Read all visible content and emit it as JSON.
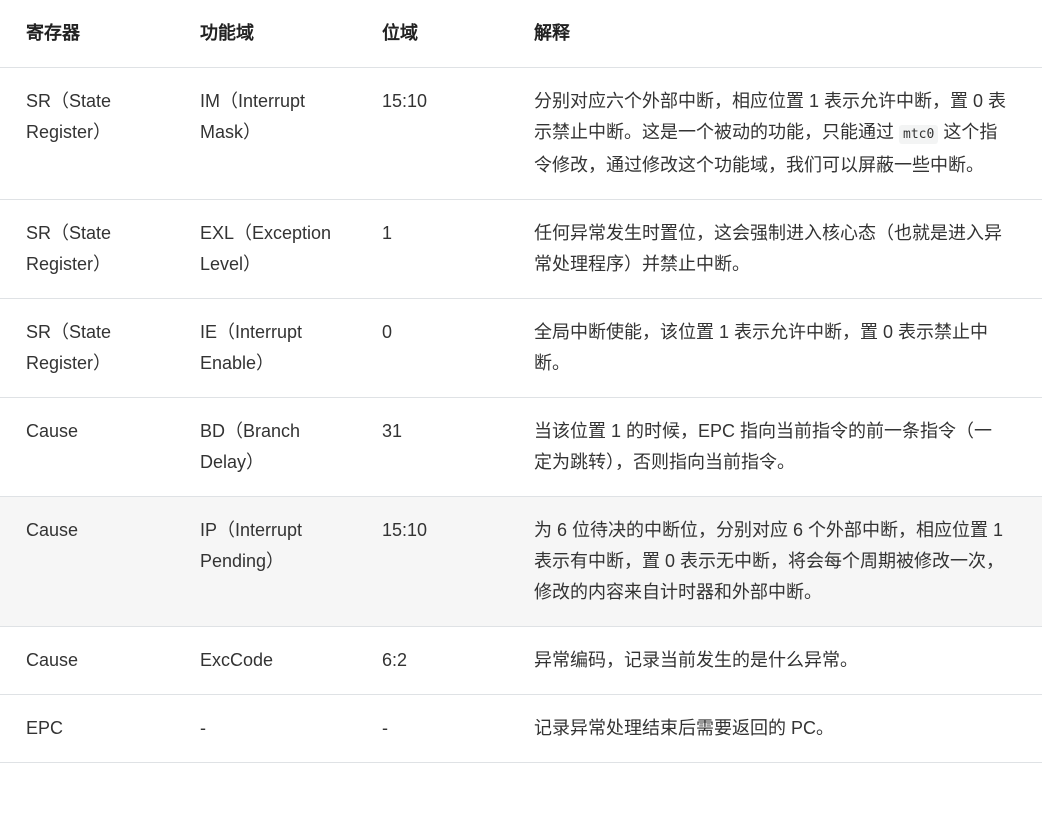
{
  "table": {
    "headers": [
      "寄存器",
      "功能域",
      "位域",
      "解释"
    ],
    "rows": [
      {
        "register": "SR（State Register）",
        "field": "IM（Interrupt Mask）",
        "bits": "15:10",
        "desc_before_code": "分别对应六个外部中断，相应位置 1 表示允许中断，置 0 表示禁止中断。这是一个被动的功能，只能通过 ",
        "desc_code": "mtc0",
        "desc_after_code": " 这个指令修改，通过修改这个功能域，我们可以屏蔽一些中断。"
      },
      {
        "register": "SR（State Register）",
        "field": "EXL（Exception Level）",
        "bits": "1",
        "desc": "任何异常发生时置位，这会强制进入核心态（也就是进入异常处理程序）并禁止中断。"
      },
      {
        "register": "SR（State Register）",
        "field": "IE（Interrupt Enable）",
        "bits": "0",
        "desc": "全局中断使能，该位置 1 表示允许中断，置 0 表示禁止中断。"
      },
      {
        "register": "Cause",
        "field": "BD（Branch Delay）",
        "bits": "31",
        "desc": "当该位置 1 的时候，EPC 指向当前指令的前一条指令（一定为跳转），否则指向当前指令。"
      },
      {
        "register": "Cause",
        "field": "IP（Interrupt Pending）",
        "bits": "15:10",
        "desc": "为 6 位待决的中断位，分别对应 6 个外部中断，相应位置 1 表示有中断，置 0 表示无中断，将会每个周期被修改一次，修改的内容来自计时器和外部中断。"
      },
      {
        "register": "Cause",
        "field": "ExcCode",
        "bits": "6:2",
        "desc": "异常编码，记录当前发生的是什么异常。"
      },
      {
        "register": "EPC",
        "field": "-",
        "bits": "-",
        "desc": "记录异常处理结束后需要返回的 PC。"
      }
    ]
  }
}
